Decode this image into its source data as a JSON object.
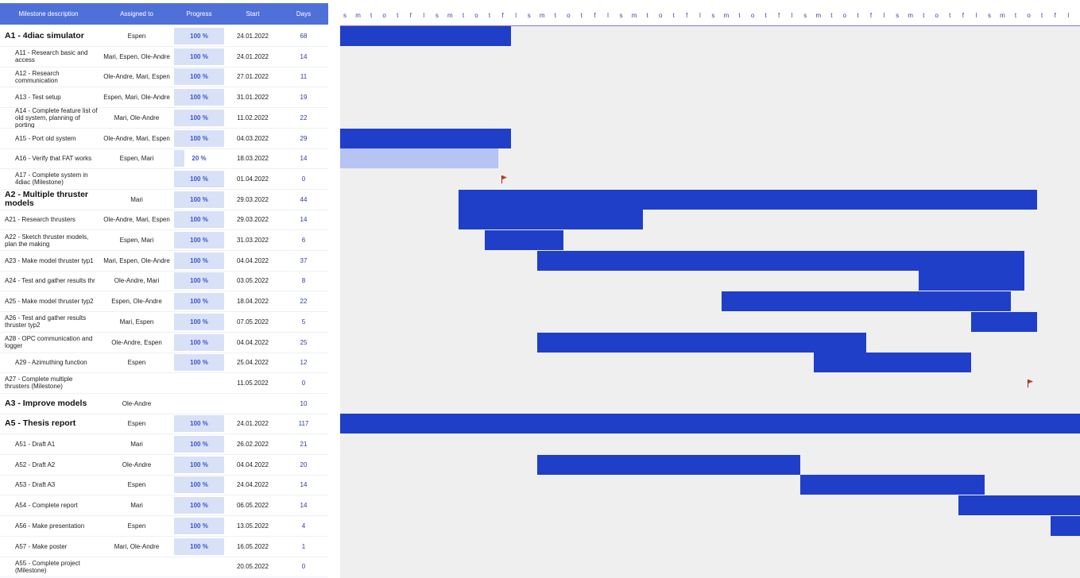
{
  "header": {
    "milestone": "Milestone description",
    "assigned": "Assigned to",
    "progress": "Progress",
    "start": "Start",
    "days": "Days"
  },
  "day_letters": "s m t o t f l s m t o t f l s m t o t f l s m t o t f l s m t o t f l s m t o t f l s m t o t f l s m t o t f l s m t o t f l s m t o t f l s m t o t f l s m t o t f l s m t o t f l s m t o t f l",
  "rows": [
    {
      "id": "A1",
      "desc": "A1 - 4diac simulator",
      "level": "main",
      "assigned": "Espen",
      "progress": "100 %",
      "pct": 100,
      "start": "24.01.2022",
      "days": "68"
    },
    {
      "id": "A11",
      "desc": "A11 - Research basic and access",
      "level": "sub",
      "assigned": "Mari, Espen, Ole-Andre",
      "progress": "100 %",
      "pct": 100,
      "start": "24.01.2022",
      "days": "14"
    },
    {
      "id": "A12",
      "desc": "A12 - Research communication",
      "level": "sub",
      "assigned": "Ole-Andre, Mari, Espen",
      "progress": "100 %",
      "pct": 100,
      "start": "27.01.2022",
      "days": "11"
    },
    {
      "id": "A13",
      "desc": "A13 - Test setup",
      "level": "sub",
      "assigned": "Espen, Mari, Ole-Andre",
      "progress": "100 %",
      "pct": 100,
      "start": "31.01.2022",
      "days": "19"
    },
    {
      "id": "A14",
      "desc": "A14 - Complete feature list of old system, planning of porting",
      "level": "sub",
      "assigned": "Mari, Ole-Andre",
      "progress": "100 %",
      "pct": 100,
      "start": "11.02.2022",
      "days": "22"
    },
    {
      "id": "A15",
      "desc": "A15 - Port old system",
      "level": "sub",
      "assigned": "Ole-Andre, Mari, Espen",
      "progress": "100 %",
      "pct": 100,
      "start": "04.03.2022",
      "days": "29"
    },
    {
      "id": "A16",
      "desc": "A16 - Verify that FAT works",
      "level": "sub",
      "assigned": "Espen, Mari",
      "progress": "20 %",
      "pct": 20,
      "start": "18.03.2022",
      "days": "14"
    },
    {
      "id": "A17",
      "desc": "A17 - Complete system in 4diac (Milestone)",
      "level": "sub",
      "assigned": "",
      "progress": "100 %",
      "pct": 100,
      "start": "01.04.2022",
      "days": "0"
    },
    {
      "id": "A2",
      "desc": "A2 - Multiple thruster models",
      "level": "main",
      "assigned": "Mari",
      "progress": "100 %",
      "pct": 100,
      "start": "29.03.2022",
      "days": "44"
    },
    {
      "id": "A21",
      "desc": "A21 - Research thrusters",
      "level": "mid",
      "assigned": "Ole-Andre, Mari, Espen",
      "progress": "100 %",
      "pct": 100,
      "start": "29.03.2022",
      "days": "14"
    },
    {
      "id": "A22",
      "desc": "A22 - Sketch thruster models, plan the making",
      "level": "mid",
      "assigned": "Espen, Mari",
      "progress": "100 %",
      "pct": 100,
      "start": "31.03.2022",
      "days": "6"
    },
    {
      "id": "A23",
      "desc": "A23 - Make model thruster typ1",
      "level": "mid",
      "assigned": "Mari, Espen, Ole-Andre",
      "progress": "100 %",
      "pct": 100,
      "start": "04.04.2022",
      "days": "37"
    },
    {
      "id": "A24",
      "desc": "A24 - Test and gather results thr",
      "level": "mid",
      "assigned": "Ole-Andre, Mari",
      "progress": "100 %",
      "pct": 100,
      "start": "03.05.2022",
      "days": "8"
    },
    {
      "id": "A25",
      "desc": "A25 - Make model thruster typ2",
      "level": "mid",
      "assigned": "Espen, Ole-Andre",
      "progress": "100 %",
      "pct": 100,
      "start": "18.04.2022",
      "days": "22"
    },
    {
      "id": "A26",
      "desc": "A26 -  Test and gather results thruster typ2",
      "level": "mid",
      "assigned": "Mari, Espen",
      "progress": "100 %",
      "pct": 100,
      "start": "07.05.2022",
      "days": "5"
    },
    {
      "id": "A28",
      "desc": "A28 - OPC communication and logger",
      "level": "mid",
      "assigned": "Ole-Andre, Espen",
      "progress": "100 %",
      "pct": 100,
      "start": "04.04.2022",
      "days": "25"
    },
    {
      "id": "A29",
      "desc": "A29 - Azimuthing function",
      "level": "sub",
      "assigned": "Espen",
      "progress": "100 %",
      "pct": 100,
      "start": "25.04.2022",
      "days": "12"
    },
    {
      "id": "A27",
      "desc": "A27 - Complete multiple thrusters (Milestone)",
      "level": "mid",
      "assigned": "",
      "progress": "",
      "pct": 0,
      "start": "11.05.2022",
      "days": "0"
    },
    {
      "id": "A3",
      "desc": "A3 - Improve models",
      "level": "main",
      "assigned": "Ole-Andre",
      "progress": "",
      "pct": 0,
      "start": "",
      "days": "10"
    },
    {
      "id": "A5",
      "desc": "A5 - Thesis report",
      "level": "main",
      "assigned": "Espen",
      "progress": "100 %",
      "pct": 100,
      "start": "24.01.2022",
      "days": "117"
    },
    {
      "id": "A51",
      "desc": "A51 - Draft A1",
      "level": "sub",
      "assigned": "Mari",
      "progress": "100 %",
      "pct": 100,
      "start": "26.02.2022",
      "days": "21"
    },
    {
      "id": "A52",
      "desc": "A52 - Draft A2",
      "level": "sub",
      "assigned": "Ole-Andre",
      "progress": "100 %",
      "pct": 100,
      "start": "04.04.2022",
      "days": "20"
    },
    {
      "id": "A53",
      "desc": "A53 - Draft A3",
      "level": "sub",
      "assigned": "Espen",
      "progress": "100 %",
      "pct": 100,
      "start": "24.04.2022",
      "days": "14"
    },
    {
      "id": "A54",
      "desc": "A54 - Complete report",
      "level": "sub",
      "assigned": "Mari",
      "progress": "100 %",
      "pct": 100,
      "start": "06.05.2022",
      "days": "14"
    },
    {
      "id": "A56",
      "desc": "A56 - Make presentation",
      "level": "sub",
      "assigned": "Espen",
      "progress": "100 %",
      "pct": 100,
      "start": "13.05.2022",
      "days": "4"
    },
    {
      "id": "A57",
      "desc": "A57 - Make poster",
      "level": "sub",
      "assigned": "Mari, Ole-Andre",
      "progress": "100 %",
      "pct": 100,
      "start": "16.05.2022",
      "days": "1"
    },
    {
      "id": "A55",
      "desc": "A55 - Complete project (Milestone)",
      "level": "sub",
      "assigned": "",
      "progress": "",
      "pct": 0,
      "start": "20.05.2022",
      "days": "0"
    }
  ],
  "gantt": {
    "visible_start": "2022-03-19",
    "bars": [
      {
        "row": 0,
        "start": "2022-03-19",
        "end": "2022-04-01",
        "style": "done"
      },
      {
        "row": 5,
        "start": "2022-03-19",
        "end": "2022-04-01",
        "style": "done"
      },
      {
        "row": 6,
        "start": "2022-03-19",
        "end": "2022-03-31",
        "style": "partial"
      },
      {
        "row": 8,
        "start": "2022-03-28",
        "end": "2022-05-11",
        "style": "done"
      },
      {
        "row": 9,
        "start": "2022-03-28",
        "end": "2022-04-11",
        "style": "done"
      },
      {
        "row": 10,
        "start": "2022-03-30",
        "end": "2022-04-05",
        "style": "done"
      },
      {
        "row": 11,
        "start": "2022-04-03",
        "end": "2022-05-10",
        "style": "done"
      },
      {
        "row": 12,
        "start": "2022-05-02",
        "end": "2022-05-10",
        "style": "done"
      },
      {
        "row": 13,
        "start": "2022-04-17",
        "end": "2022-05-09",
        "style": "done"
      },
      {
        "row": 14,
        "start": "2022-05-06",
        "end": "2022-05-11",
        "style": "done"
      },
      {
        "row": 15,
        "start": "2022-04-03",
        "end": "2022-04-28",
        "style": "done"
      },
      {
        "row": 16,
        "start": "2022-04-24",
        "end": "2022-05-06",
        "style": "done"
      },
      {
        "row": 19,
        "start": "2022-03-19",
        "end": "2022-05-22",
        "style": "done"
      },
      {
        "row": 21,
        "start": "2022-04-03",
        "end": "2022-04-23",
        "style": "done"
      },
      {
        "row": 22,
        "start": "2022-04-23",
        "end": "2022-05-07",
        "style": "done"
      },
      {
        "row": 23,
        "start": "2022-05-05",
        "end": "2022-05-19",
        "style": "done"
      },
      {
        "row": 24,
        "start": "2022-05-12",
        "end": "2022-05-16",
        "style": "done"
      },
      {
        "row": 25,
        "start": "2022-05-15",
        "end": "2022-05-16",
        "style": "done"
      }
    ],
    "milestones": [
      {
        "row": 7,
        "date": "2022-03-31"
      },
      {
        "row": 17,
        "date": "2022-05-10"
      }
    ],
    "colors": {
      "done": "#1f3fc9",
      "partial": "#b7c4f3",
      "header": "#4f70d9",
      "flag": "#c0392b"
    }
  }
}
